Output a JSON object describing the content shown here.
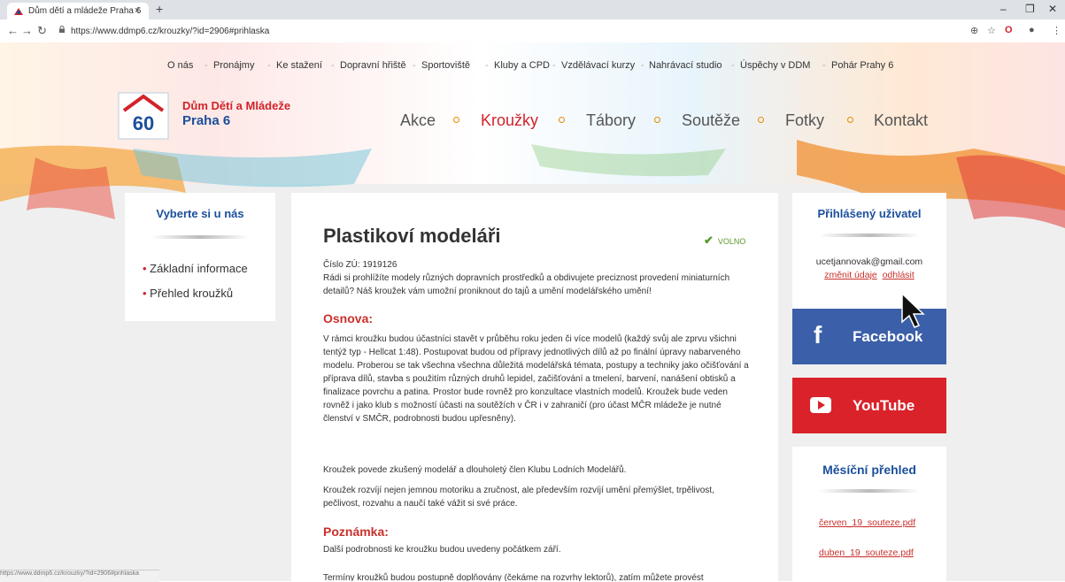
{
  "browser": {
    "tab_title": "Dům dětí a mládeže Praha 6",
    "tab_close": "×",
    "new_tab": "+",
    "url": "https://www.ddmp6.cz/krouzky/?id=2906#prihlaska",
    "status_url": "https://www.ddmp6.cz/krouzky/?id=2906#prihlaska"
  },
  "topnav": [
    "O nás",
    "Pronájmy",
    "Ke stažení",
    "Dopravní hřiště",
    "Sportoviště",
    "Kluby a CPD",
    "Vzdělávací kurzy",
    "Nahrávací studio",
    "Úspěchy v DDM",
    "Pohár Prahy 6"
  ],
  "logo": {
    "line1": "Dům Dětí a Mládeže",
    "line2": "Praha 6",
    "badge": "60"
  },
  "mainnav": [
    "Akce",
    "Kroužky",
    "Tábory",
    "Soutěže",
    "Fotky",
    "Kontakt"
  ],
  "left": {
    "title": "Vyberte si u nás",
    "links": [
      "Základní informace",
      "Přehled kroužků"
    ]
  },
  "content": {
    "title": "Plastikoví modeláři",
    "status": "VOLNO",
    "cislo": "Číslo ZÚ: 1919126",
    "intro": "Rádi si prohlížíte modely různých dopravních prostředků a obdivujete preciznost provedení miniaturních detailů? Náš kroužek vám umožní proniknout do tajů a umění modelářského umění!",
    "h_osnova": "Osnova:",
    "osnova": "V rámci kroužku budou účastníci stavět v průběhu roku jeden či více modelů (každý svůj ale zprvu všichni tentýž typ - Hellcat 1:48). Postupovat budou od přípravy jednotlivých dílů až po finální úpravy nabarveného modelu. Proberou se tak všechna všechna důležitá modelářská témata, postupy a techniky jako očišťování a příprava dílů, stavba s použitím různých druhů lepidel, začišťování a tmelení, barvení, nanášení obtisků a finalizace povrchu a patina. Prostor bude rovněž pro konzultace vlastních modelů. Kroužek bude veden rovněž i jako klub s možností účasti na soutěžích v ČR i v zahraničí (pro účast MČR mládeže je nutné členství v SMČR, podrobnosti budou upřesněny).",
    "p2": "Kroužek povede zkušený modelář a dlouholetý člen Klubu Lodních Modelářů.",
    "p3": "Kroužek rozvíjí nejen jemnou motoriku a zručnost, ale především rozvíjí umění přemýšlet, trpělivost, pečlivost, rozvahu a naučí také vážit si své práce.",
    "h_poznamka": "Poznámka:",
    "p4": "Další podrobnosti ke kroužku budou uvedeny počátkem září.",
    "p5": "Termíny kroužků budou postupně doplňovány (čekáme na rozvrhy lektorů), zatím můžete provést"
  },
  "right": {
    "user_title": "Přihlášený uživatel",
    "email": "ucetjannovak@gmail.com",
    "change": "změnit údaje",
    "logout": "odhlásit",
    "facebook": "Facebook",
    "youtube": "YouTube",
    "monthly_title": "Měsíční přehled",
    "files": [
      "červen_19_souteze.pdf",
      "duben_19_souteze.pdf"
    ]
  },
  "colors": {
    "red": "#d2232a",
    "blue": "#1b4f9c",
    "facebook": "#3b5fa8",
    "youtube": "#d9222a",
    "green": "#5a9a2a"
  }
}
